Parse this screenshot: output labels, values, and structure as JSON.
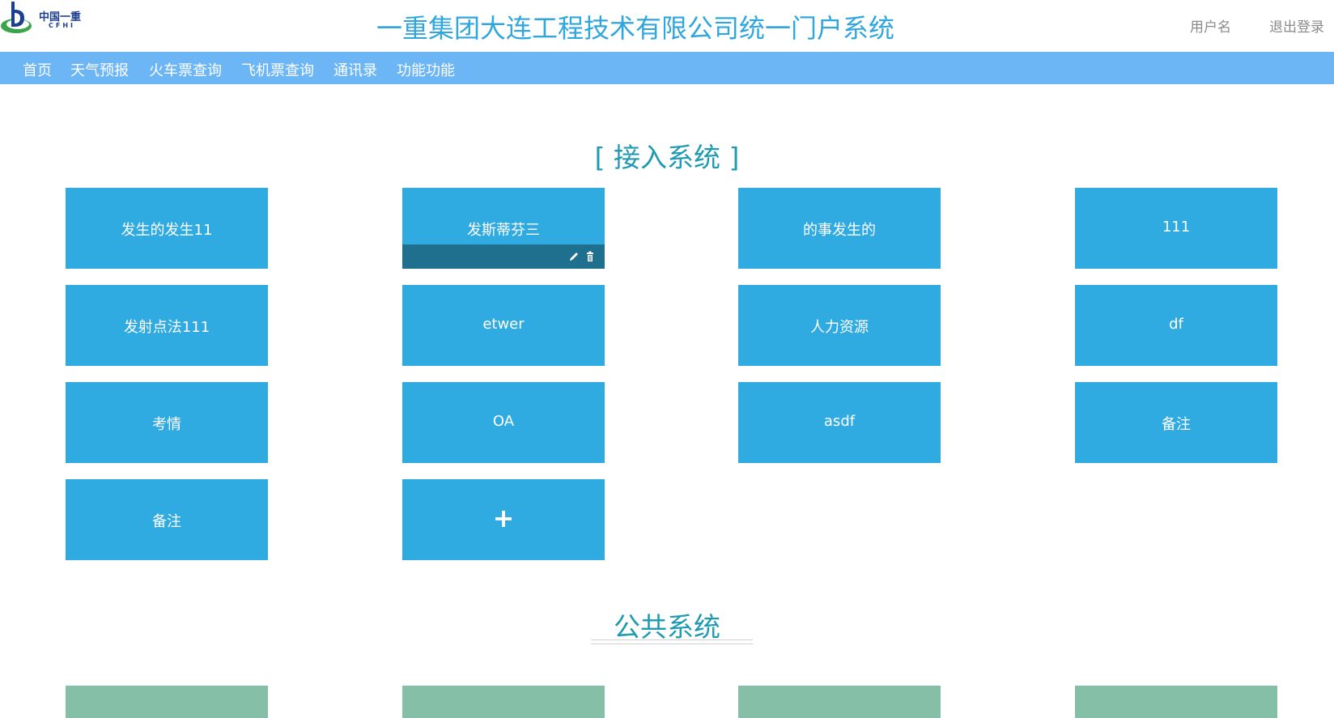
{
  "header": {
    "logo": {
      "cn_text": "中国一重",
      "en_text": "CFHI",
      "icon": "cfhi-logo-icon"
    },
    "title": "一重集团大连工程技术有限公司统一门户系统",
    "username": "用户名",
    "logout": "退出登录"
  },
  "nav": {
    "items": [
      {
        "label": "首页"
      },
      {
        "label": "天气预报"
      },
      {
        "label": "火车票查询"
      },
      {
        "label": "飞机票查询"
      },
      {
        "label": "通讯录"
      },
      {
        "label": "功能功能"
      }
    ]
  },
  "access": {
    "title": "[ 接入系统 ]",
    "tiles": [
      {
        "label": "发生的发生11"
      },
      {
        "label": "发斯蒂芬三"
      },
      {
        "label": "的事发生的"
      },
      {
        "label": "111"
      },
      {
        "label": "发射点法111"
      },
      {
        "label": "etwer"
      },
      {
        "label": "人力资源"
      },
      {
        "label": "df"
      },
      {
        "label": "考情"
      },
      {
        "label": "OA"
      },
      {
        "label": "asdf"
      },
      {
        "label": "备注"
      },
      {
        "label": "备注"
      }
    ],
    "add_label": "+"
  },
  "public": {
    "title": "公共系统"
  },
  "colors": {
    "tile": "#30abe2",
    "tile_bar": "#1f6f8f",
    "nav": "#6cb6f6",
    "title": "#2fa6dd",
    "section_title": "#1e9bb0",
    "public_tile": "#85bfa8"
  }
}
